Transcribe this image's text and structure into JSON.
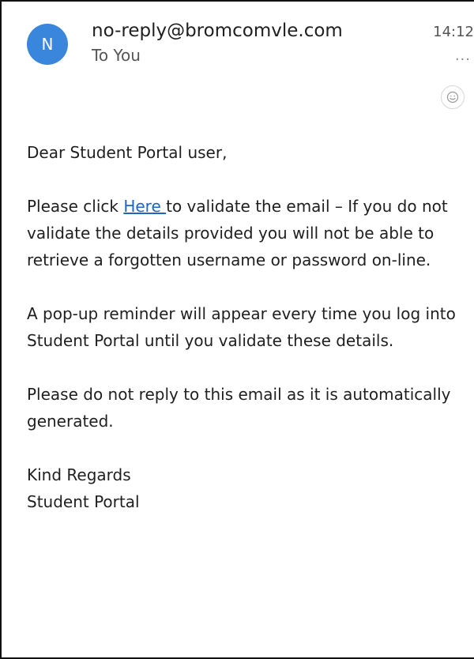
{
  "email": {
    "avatar_initial": "N",
    "sender": "no-reply@bromcomvle.com",
    "recipient": "To You",
    "time": "14:12",
    "more_label": "...",
    "icons": {
      "react": "smiley-react-icon",
      "more": "more-options-icon"
    },
    "colors": {
      "avatar_bg": "#3a86dd",
      "link": "#1b66c9"
    }
  },
  "body": {
    "greeting": "Dear Student Portal user,",
    "p1_before": "Please click ",
    "p1_link": "Here ",
    "p1_after": "to validate the email – If you do not validate the details provided you will not be able to retrieve a forgotten username or password on-line.",
    "p2": "A pop-up reminder will appear every time you log into Student Portal until you validate these details.",
    "p3": "Please do not reply to this email as it is automatically generated.",
    "closing": "Kind Regards",
    "signature": "Student Portal"
  }
}
